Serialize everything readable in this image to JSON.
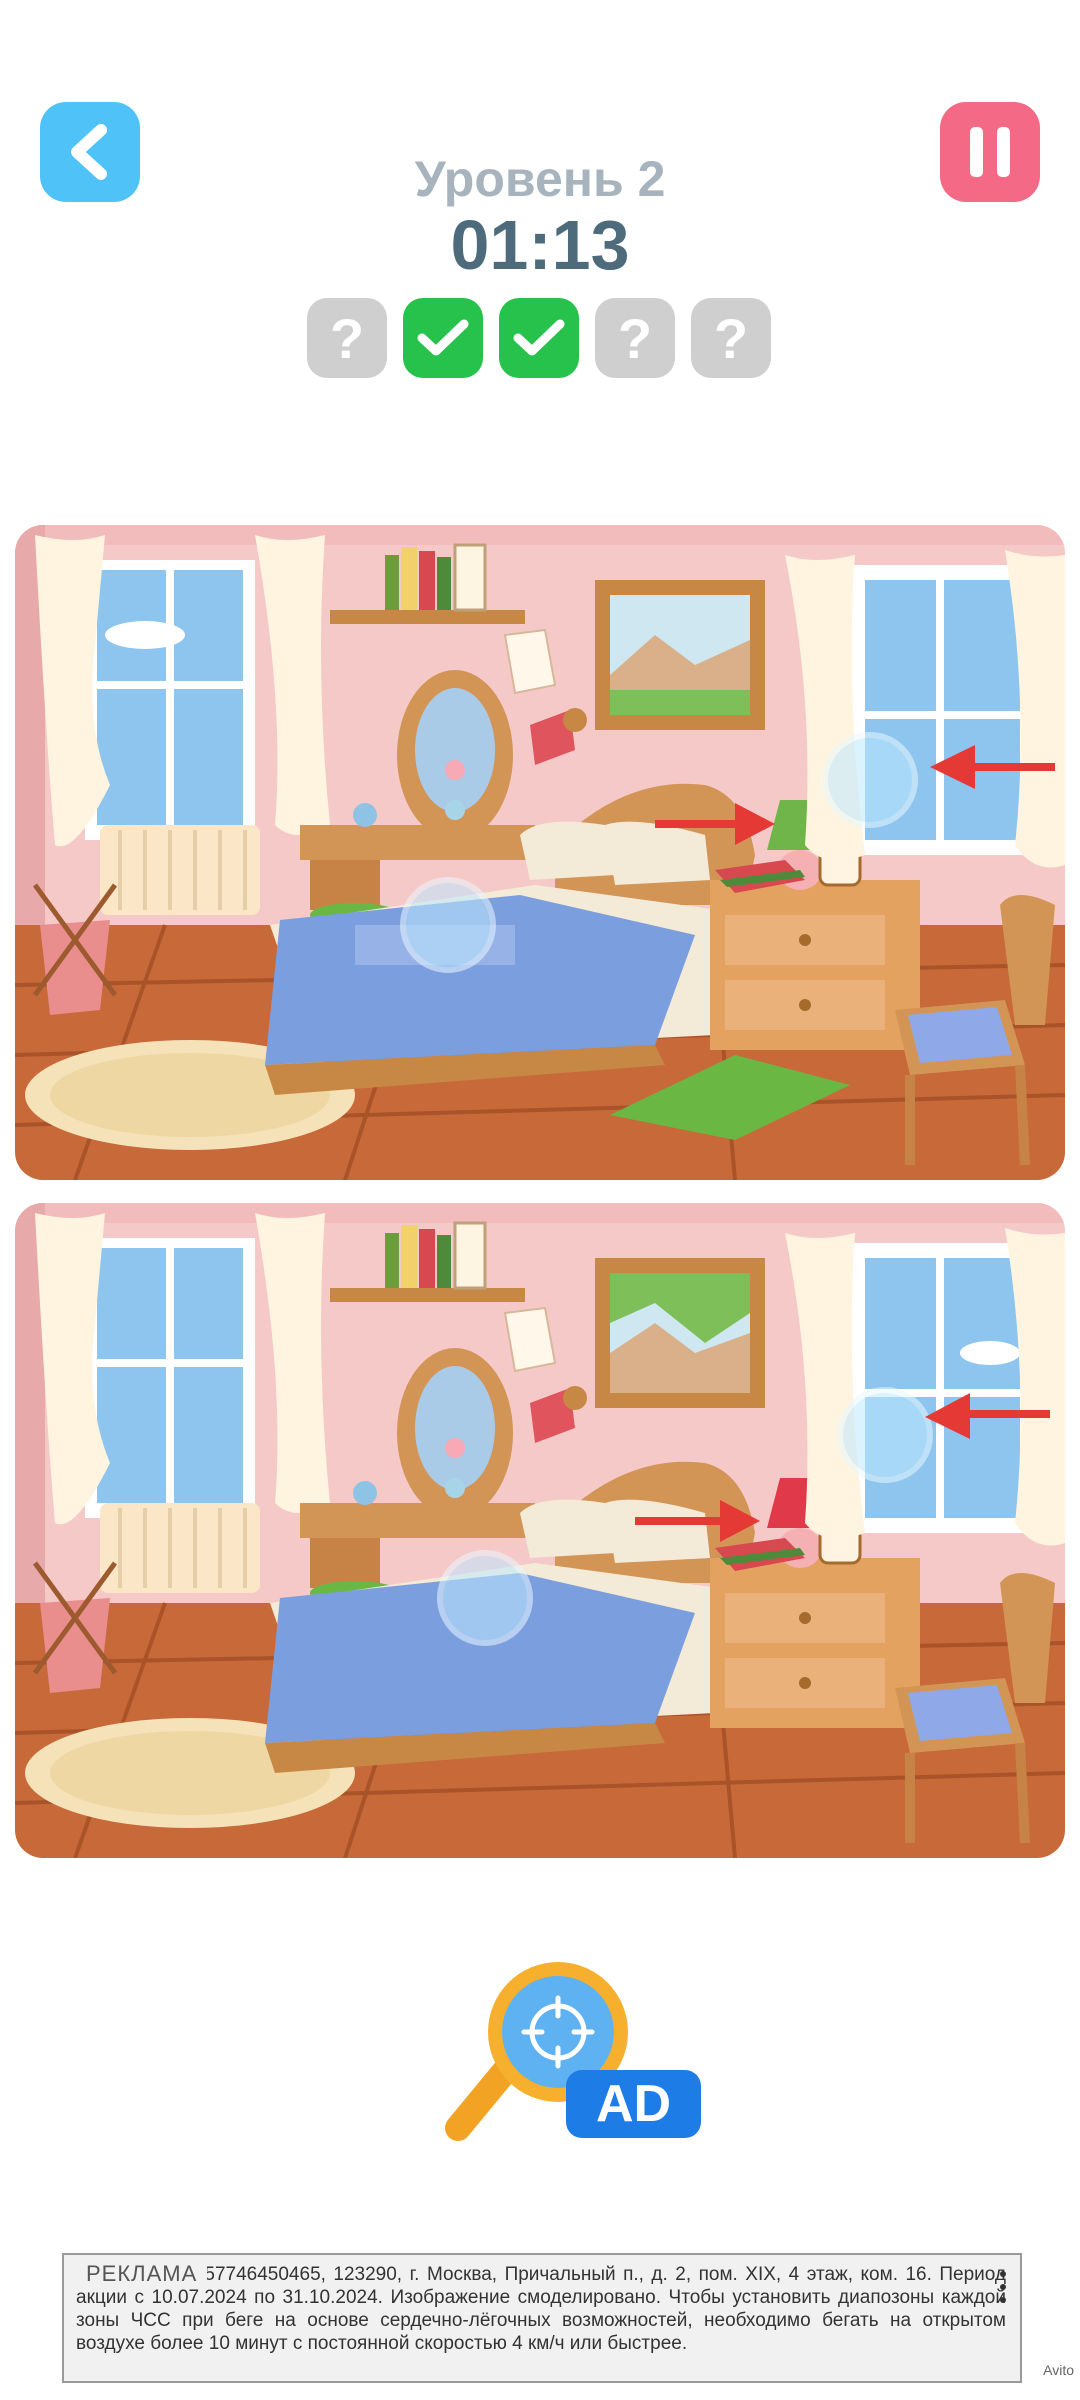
{
  "header": {
    "level_title": "Уровень 2",
    "timer": "01:13",
    "back_icon": "chevron-left-icon",
    "pause_icon": "pause-icon"
  },
  "progress": {
    "slots": [
      {
        "state": "unknown",
        "glyph": "?"
      },
      {
        "state": "found",
        "glyph": "check"
      },
      {
        "state": "found",
        "glyph": "check"
      },
      {
        "state": "unknown",
        "glyph": "?"
      },
      {
        "state": "unknown",
        "glyph": "?"
      }
    ],
    "found_count": 2,
    "total": 5
  },
  "scenes": {
    "top": {
      "name": "original-bedroom"
    },
    "bottom": {
      "name": "modified-bedroom"
    }
  },
  "hint": {
    "icon": "magnifier-icon",
    "badge": "AD"
  },
  "ad_banner": {
    "label": "РЕКЛАМА",
    "text": "«...»,   ОГРН 1157746450465,   123290,   г. Москва,   Причальный п., д. 2, пом. XIX, 4 этаж, ком. 16. Период акции с 10.07.2024 по 31.10.2024. Изображение смоделировано. Чтобы установить диапозоны каждой зоны ЧСС при беге на основе сердечно-лёгочных возможностей, необходимо бегать на открытом воздухе более 10 минут с постоянной скоростью 4 км/ч или быстрее.",
    "watermark": "Avito"
  },
  "colors": {
    "back_button": "#4fc3f7",
    "pause_button": "#f46a86",
    "found_slot": "#27c24c",
    "unknown_slot": "#cfcfcf",
    "timer_text": "#4e6b7c",
    "level_text": "#a8b4bd"
  }
}
